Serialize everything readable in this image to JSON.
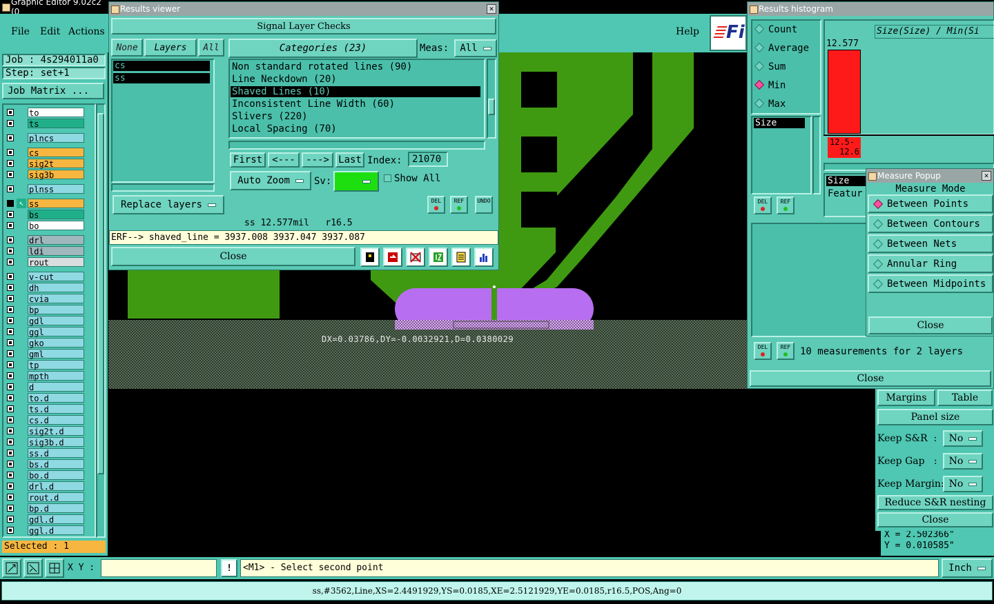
{
  "main": {
    "title": "Graphic Editor 9.02c2 (0",
    "menu": [
      "File",
      "Edit",
      "Actions"
    ],
    "help": "Help",
    "logo": "Fi",
    "job": "Job : 4s294011a0",
    "step": "Step: set+1",
    "job_matrix": "Job Matrix ...",
    "selected": "Selected : 1",
    "layers": [
      {
        "name": "to",
        "color": "#ffffff"
      },
      {
        "name": "ts",
        "color": "#1fb08a"
      },
      {
        "name": "plncs",
        "color": "#8fd9e3"
      },
      {
        "name": "cs",
        "color": "#f7b640"
      },
      {
        "name": "sig2t",
        "color": "#f7b640"
      },
      {
        "name": "sig3b",
        "color": "#f7b640"
      },
      {
        "name": "plnss",
        "color": "#8fd9e3"
      },
      {
        "name": "ss",
        "color": "#f7b640"
      },
      {
        "name": "bs",
        "color": "#1fb08a"
      },
      {
        "name": "bo",
        "color": "#ffffff"
      },
      {
        "name": "drl",
        "color": "#9fb7bd"
      },
      {
        "name": "ldi",
        "color": "#9fb7bd"
      },
      {
        "name": "rout",
        "color": "#d9dde0"
      },
      {
        "name": "v-cut",
        "color": "#8fd9e3"
      },
      {
        "name": "dh",
        "color": "#8fd9e3"
      },
      {
        "name": "cvia",
        "color": "#8fd9e3"
      },
      {
        "name": "bp",
        "color": "#8fd9e3"
      },
      {
        "name": "gdl",
        "color": "#8fd9e3"
      },
      {
        "name": "ggl",
        "color": "#8fd9e3"
      },
      {
        "name": "gko",
        "color": "#8fd9e3"
      },
      {
        "name": "gml",
        "color": "#8fd9e3"
      },
      {
        "name": "tp",
        "color": "#8fd9e3"
      },
      {
        "name": "mpth",
        "color": "#8fd9e3"
      },
      {
        "name": "d",
        "color": "#8fd9e3"
      },
      {
        "name": "to.d",
        "color": "#8fd9e3"
      },
      {
        "name": "ts.d",
        "color": "#8fd9e3"
      },
      {
        "name": "cs.d",
        "color": "#8fd9e3"
      },
      {
        "name": "sig2t.d",
        "color": "#8fd9e3"
      },
      {
        "name": "sig3b.d",
        "color": "#8fd9e3"
      },
      {
        "name": "ss.d",
        "color": "#8fd9e3"
      },
      {
        "name": "bs.d",
        "color": "#8fd9e3"
      },
      {
        "name": "bo.d",
        "color": "#8fd9e3"
      },
      {
        "name": "drl.d",
        "color": "#8fd9e3"
      },
      {
        "name": "rout.d",
        "color": "#8fd9e3"
      },
      {
        "name": "bp.d",
        "color": "#8fd9e3"
      },
      {
        "name": "gdl.d",
        "color": "#8fd9e3"
      },
      {
        "name": "ggl.d",
        "color": "#8fd9e3"
      }
    ],
    "xy_label": "X Y :",
    "xy_value": "",
    "prompt": "<M1> - Select second point",
    "units": "Inch",
    "statusbar": "ss,#3562,Line,XS=2.4491929,YS=0.0185,XE=2.5121929,YE=0.0185,r16.5,POS,Ang=0",
    "measure_text": "DX=0.03786,DY=-0.0032921,D=0.0380029",
    "coord_x": "X = 2.502366\"",
    "coord_y": "Y = 0.010585\""
  },
  "results_viewer": {
    "title": "Results viewer",
    "header": "Signal Layer Checks",
    "none": "None",
    "layers": "Layers",
    "all": "All",
    "layer_items": [
      "cs",
      "ss"
    ],
    "categories_label": "Categories (23)",
    "meas_label": "Meas:",
    "meas_value": "All",
    "categories": [
      "Non standard rotated lines (90)",
      "Line Neckdown (20)",
      "Shaved Lines (10)",
      "Inconsistent Line Width (60)",
      "Slivers (220)",
      "Local Spacing (70)"
    ],
    "selected_category": 2,
    "first": "First",
    "prev": "<---",
    "next": "--->",
    "last": "Last",
    "index_label": "Index:",
    "index_value": "21070",
    "auto_zoom": "Auto Zoom",
    "sv": "Sv:",
    "show_all": "Show All",
    "replace_layers": "Replace layers",
    "del": "DEL",
    "ref": "REF",
    "undo": "UNDO",
    "info_line": "ss 12.577mil   r16.5",
    "erf_line": "ERF--> shaved_line = 3937.008 3937.047 3937.087",
    "close": "Close"
  },
  "histogram": {
    "title": "Results histogram",
    "options": [
      "Count",
      "Average",
      "Sum",
      "Min",
      "Max"
    ],
    "selected_option": 3,
    "formula": "Size(Size) / Min(Si",
    "bar_value": "12.577",
    "range_top": "12.5-",
    "range_bottom": "12.6",
    "list_item": "Size",
    "col_size": "Size",
    "col_feature": "Featur",
    "summary": "10 measurements for 2 layers",
    "close": "Close"
  },
  "measure_popup": {
    "title": "Measure Popup",
    "mode_label": "Measure Mode",
    "options": [
      "Between Points",
      "Between Contours",
      "Between Nets",
      "Annular Ring",
      "Between Midpoints"
    ],
    "selected_option": 0,
    "close": "Close"
  },
  "panel_form": {
    "margins": "Margins",
    "table": "Table",
    "panel_size": "Panel size",
    "keep_sr": "Keep S&R  :",
    "keep_gap": "Keep Gap   :",
    "keep_margin": "Keep Margin:",
    "no": "No",
    "reduce": "Reduce S&R nesting",
    "close": "Close"
  },
  "colors": {
    "panel": "#5ccab5",
    "board_green": "#3f9a12",
    "pad_purple": "#b86ef0",
    "histogram_bar": "#ff1a1a"
  }
}
